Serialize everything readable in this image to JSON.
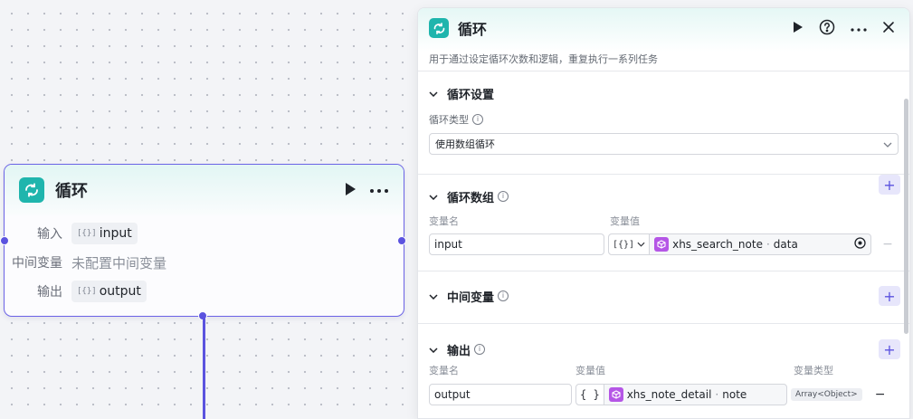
{
  "node": {
    "title": "循环",
    "rows": [
      {
        "label": "输入",
        "chip_prefix": "[{}]",
        "value": "input"
      },
      {
        "label": "中间变量",
        "value": "未配置中间变量"
      },
      {
        "label": "输出",
        "chip_prefix": "[{}]",
        "value": "output"
      }
    ]
  },
  "panel": {
    "title": "循环",
    "description": "用于通过设定循环次数和逻辑，重复执行一系列任务",
    "loop_settings": {
      "title": "循环设置",
      "type_label": "循环类型",
      "type_value": "使用数组循环"
    },
    "loop_array": {
      "title": "循环数组",
      "col_name": "变量名",
      "col_value": "变量值",
      "add_label": "+",
      "row": {
        "name": "input",
        "type_prefix": "[{}]",
        "ref_node": "xhs_search_note",
        "ref_field": "data",
        "remove": "−"
      }
    },
    "intermediate": {
      "title": "中间变量",
      "add_label": "+"
    },
    "output": {
      "title": "输出",
      "col_name": "变量名",
      "col_value": "变量值",
      "col_type": "变量类型",
      "add_label": "+",
      "row": {
        "name": "output",
        "type_prefix": "{ }",
        "ref_node": "xhs_note_detail",
        "ref_field": "note",
        "var_type": "Array<Object>",
        "remove": "−"
      }
    }
  },
  "colors": {
    "accent": "#5b53df",
    "loop_icon": "#1fb5ad",
    "ref_icon": "#b556e6"
  }
}
